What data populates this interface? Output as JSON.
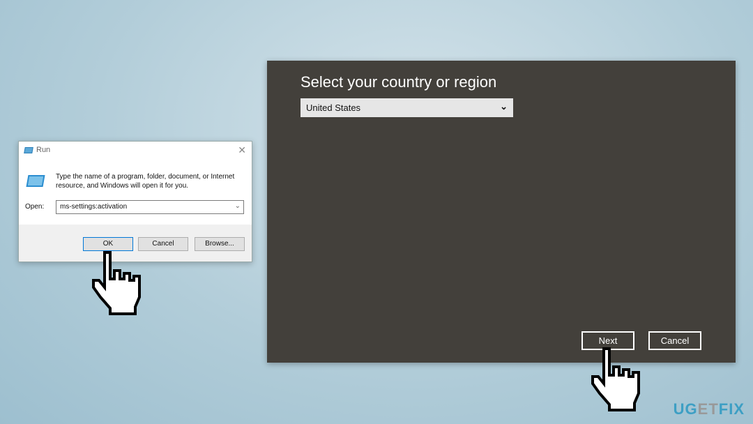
{
  "run_dialog": {
    "title": "Run",
    "description": "Type the name of a program, folder, document, or Internet resource, and Windows will open it for you.",
    "open_label": "Open:",
    "open_value": "ms-settings:activation",
    "ok": "OK",
    "cancel": "Cancel",
    "browse": "Browse..."
  },
  "oobe": {
    "heading": "Select your country or region",
    "selected_region": "United States",
    "next": "Next",
    "cancel": "Cancel"
  },
  "watermark": {
    "part1": "UG",
    "part2": "ET",
    "part3": "FIX"
  }
}
